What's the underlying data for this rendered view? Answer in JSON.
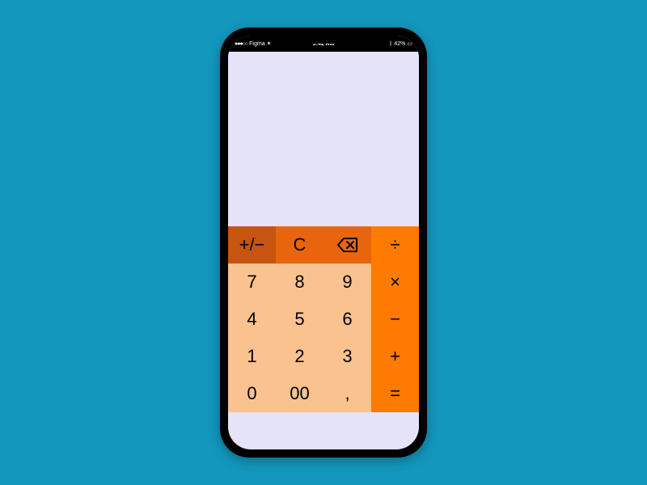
{
  "statusbar": {
    "carrier": "Figma",
    "signal_dots": "●●●○○",
    "wifi_glyph": "✶",
    "time": "9:42 AM",
    "bluetooth_glyph": "ᛒ",
    "battery_pct": "42%",
    "battery_glyph": "▭"
  },
  "keys": {
    "plusminus": "+/−",
    "clear": "C",
    "backspace": "⌫",
    "divide": "÷",
    "multiply": "×",
    "minus": "−",
    "plus": "+",
    "equals": "=",
    "n7": "7",
    "n8": "8",
    "n9": "9",
    "n4": "4",
    "n5": "5",
    "n6": "6",
    "n1": "1",
    "n2": "2",
    "n3": "3",
    "n0": "0",
    "n00": "00",
    "decimal": ","
  },
  "colors": {
    "page_bg": "#1397bd",
    "display_bg": "#e5e3f7",
    "func_dark": "#c75410",
    "func_mid": "#e8650e",
    "operator": "#ff7a00",
    "numpad": "#f9c28e"
  }
}
